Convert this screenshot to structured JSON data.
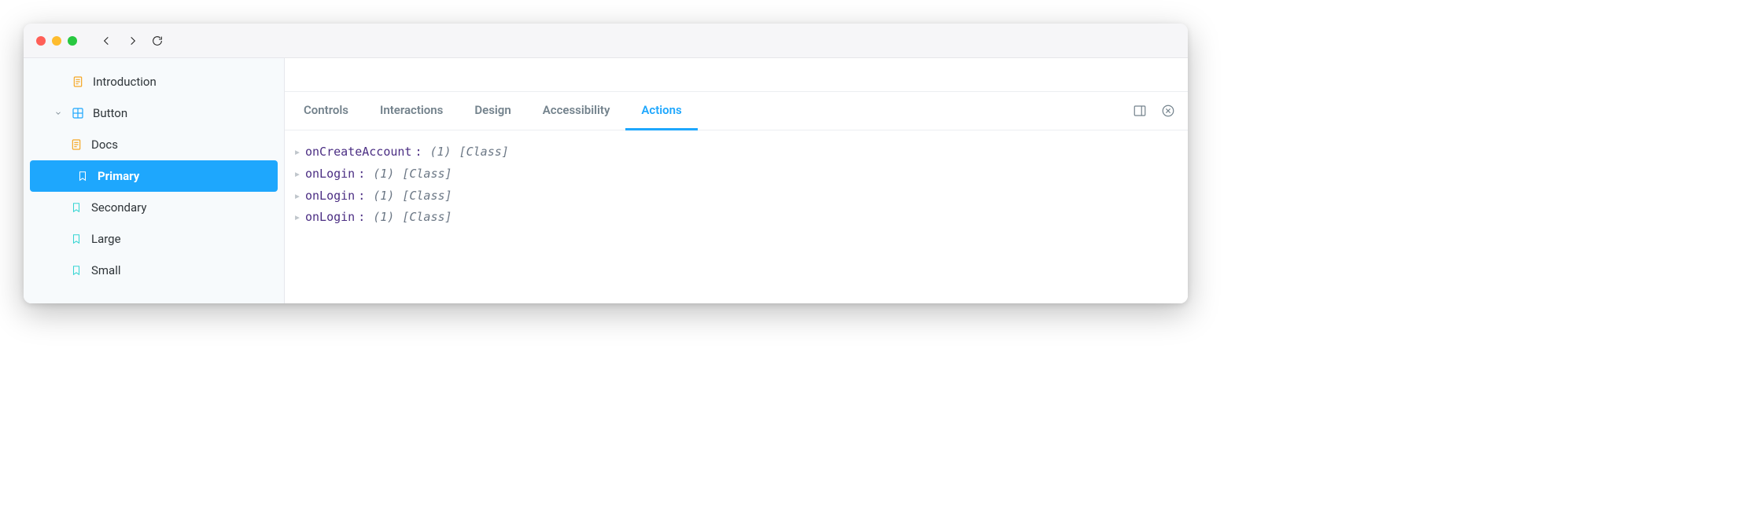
{
  "sidebar": {
    "items": [
      {
        "label": "Introduction",
        "icon": "document",
        "depth": 1,
        "caret": false,
        "active": false
      },
      {
        "label": "Button",
        "icon": "component",
        "depth": 1,
        "caret": true,
        "active": false
      },
      {
        "label": "Docs",
        "icon": "document",
        "depth": 2,
        "caret": false,
        "active": false
      },
      {
        "label": "Primary",
        "icon": "bookmark",
        "depth": 2,
        "caret": false,
        "active": true
      },
      {
        "label": "Secondary",
        "icon": "bookmark",
        "depth": 2,
        "caret": false,
        "active": false
      },
      {
        "label": "Large",
        "icon": "bookmark",
        "depth": 2,
        "caret": false,
        "active": false
      },
      {
        "label": "Small",
        "icon": "bookmark",
        "depth": 2,
        "caret": false,
        "active": false
      }
    ]
  },
  "tabs": [
    {
      "label": "Controls",
      "active": false
    },
    {
      "label": "Interactions",
      "active": false
    },
    {
      "label": "Design",
      "active": false
    },
    {
      "label": "Accessibility",
      "active": false
    },
    {
      "label": "Actions",
      "active": true
    }
  ],
  "actions_log": [
    {
      "name": "onCreateAccount",
      "count": "(1)",
      "class": "[Class]"
    },
    {
      "name": "onLogin",
      "count": "(1)",
      "class": "[Class]"
    },
    {
      "name": "onLogin",
      "count": "(1)",
      "class": "[Class]"
    },
    {
      "name": "onLogin",
      "count": "(1)",
      "class": "[Class]"
    }
  ]
}
